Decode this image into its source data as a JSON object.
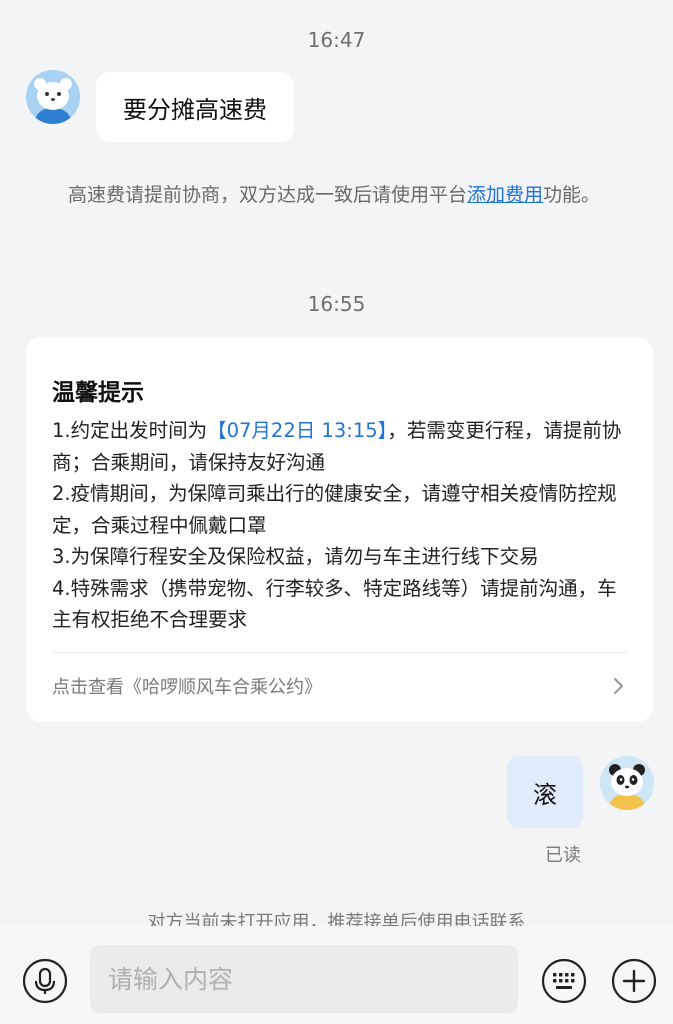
{
  "messages": {
    "time1": "16:47",
    "incoming_text": "要分摊高速费",
    "system_note": {
      "before": "高速费请提前协商，双方达成一致后请使用平台",
      "link": "添加费用",
      "after": "功能。"
    },
    "time2": "16:55"
  },
  "notice_card": {
    "title": "温馨提示",
    "item1_prefix": "1.约定出发时间为",
    "item1_time": "【07月22日 13:15】",
    "item1_suffix": "，若需变更行程，请提前协商；合乘期间，请保持友好沟通",
    "item2": "2.疫情期间，为保障司乘出行的健康安全，请遵守相关疫情防控规定，合乘过程中佩戴口罩",
    "item3": "3.为保障行程安全及保险权益，请勿与车主进行线下交易",
    "item4": "4.特殊需求（携带宠物、行李较多、特定路线等）请提前沟通，车主有权拒绝不合理要求",
    "footer_link": "点击查看《哈啰顺风车合乘公约》"
  },
  "outgoing": {
    "text": "滚",
    "status": "已读"
  },
  "bottom_note": "对方当前未打开应用，推荐接单后使用电话联系",
  "input_bar": {
    "placeholder": "请输入内容"
  },
  "icons": {
    "mic": "microphone-icon",
    "keyboard": "keyboard-icon",
    "plus": "plus-icon",
    "chevron": "chevron-right-icon"
  },
  "colors": {
    "link": "#1f73d9",
    "background": "#f3f4f6",
    "outgoing_bubble": "#e0ecf9"
  }
}
